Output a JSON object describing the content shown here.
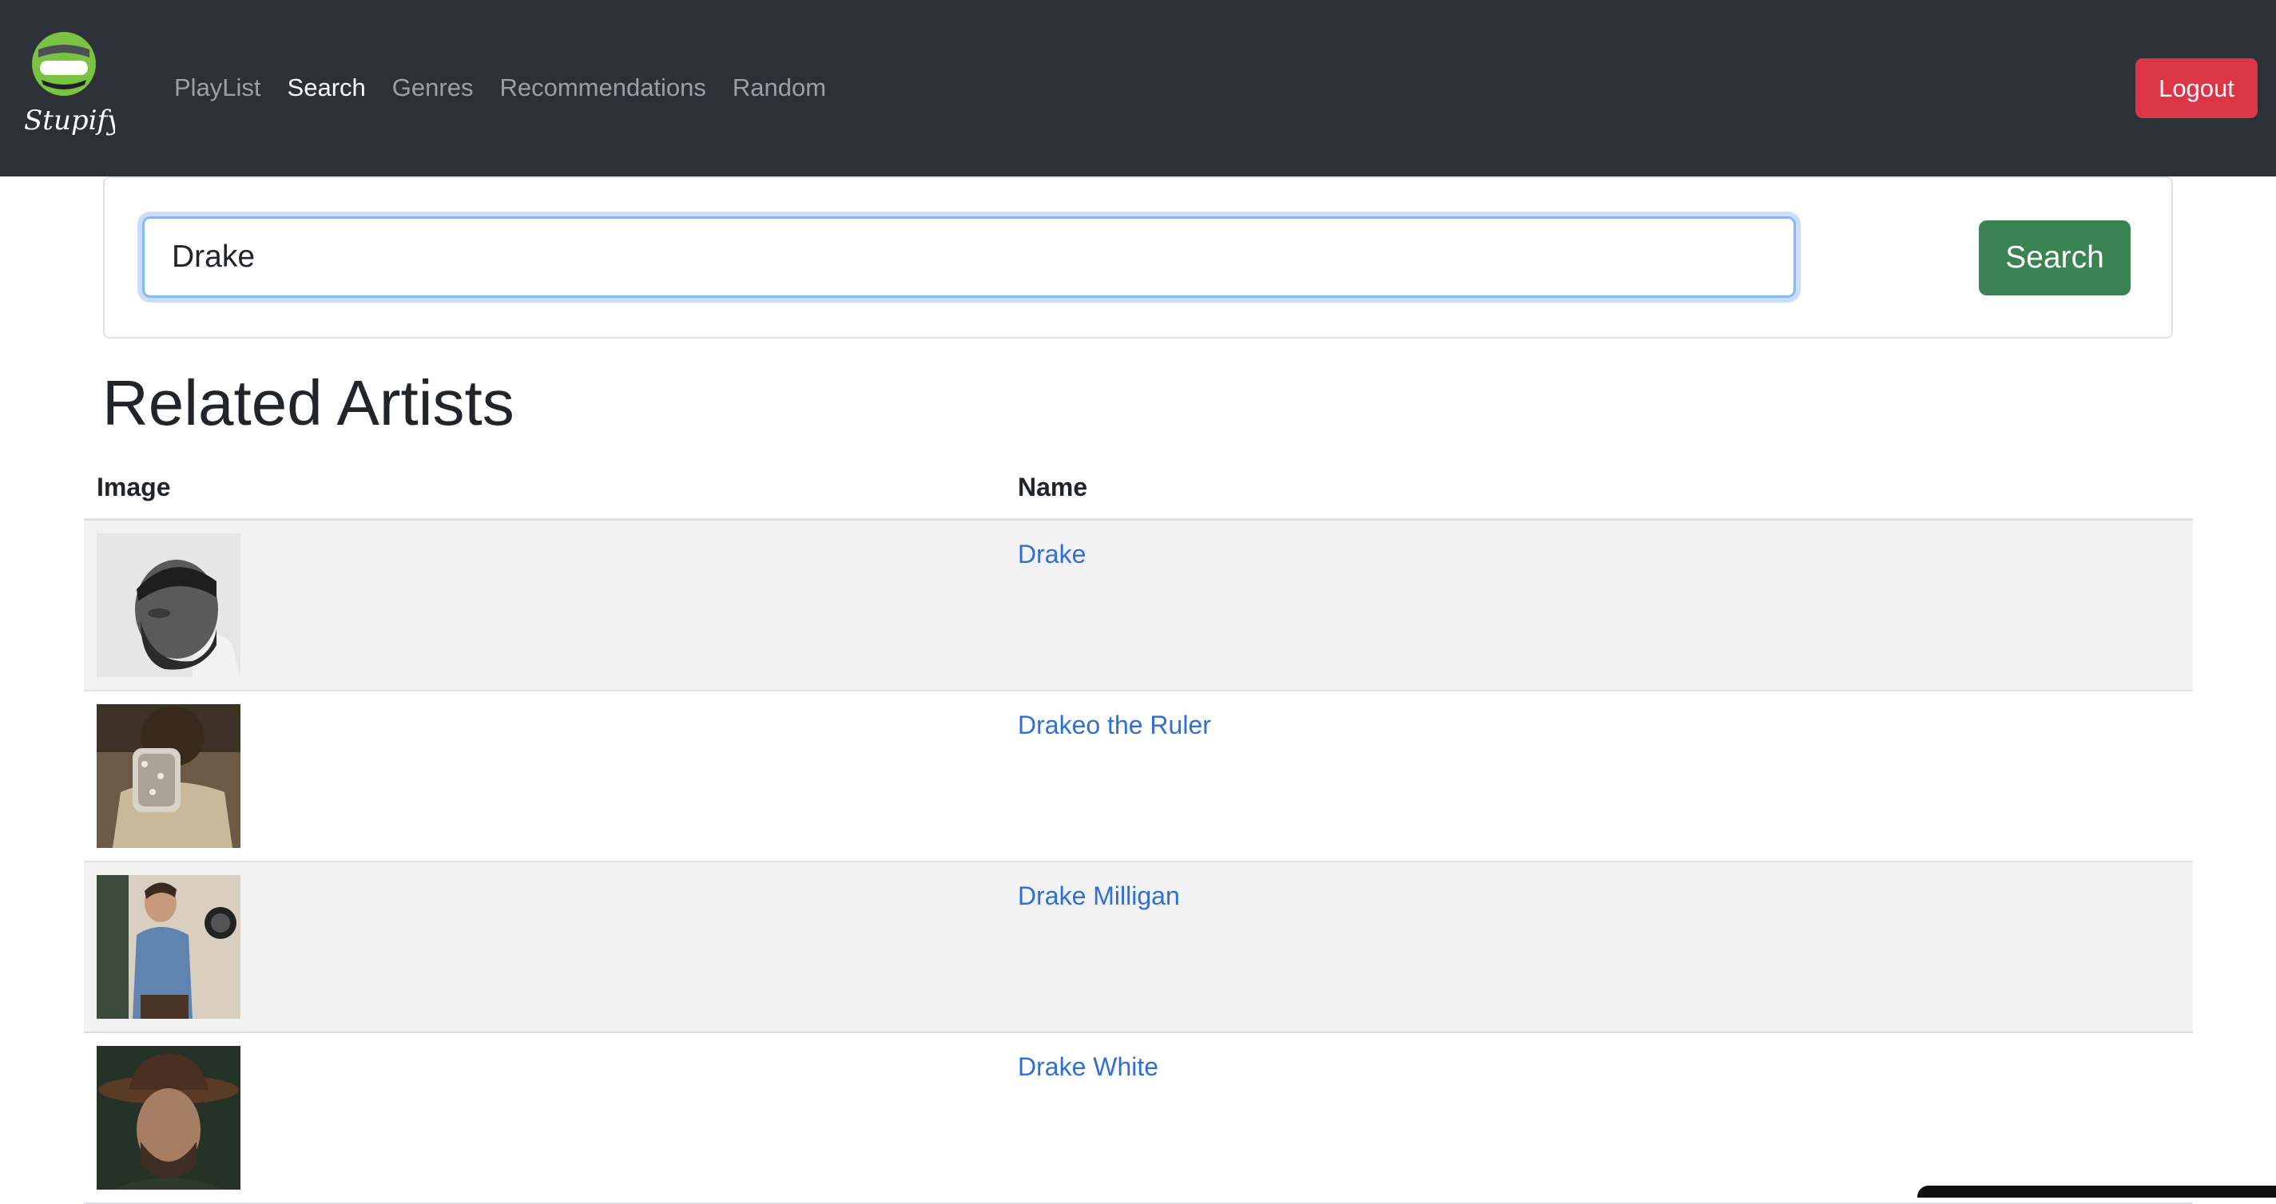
{
  "app": {
    "logo_text": "Stupify"
  },
  "nav": {
    "items": [
      {
        "label": "PlayList",
        "active": false
      },
      {
        "label": "Search",
        "active": true
      },
      {
        "label": "Genres",
        "active": false
      },
      {
        "label": "Recommendations",
        "active": false
      },
      {
        "label": "Random",
        "active": false
      }
    ],
    "logout_label": "Logout"
  },
  "search": {
    "value": "Drake",
    "button_label": "Search"
  },
  "results": {
    "title": "Related Artists",
    "columns": [
      "Image",
      "Name"
    ],
    "rows": [
      {
        "name": "Drake"
      },
      {
        "name": "Drakeo the Ruler"
      },
      {
        "name": "Drake Milligan"
      },
      {
        "name": "Drake White"
      }
    ]
  },
  "colors": {
    "navbar_bg": "#2c3037",
    "logout": "#dc3545",
    "search_button": "#3a8454",
    "link": "#2f6fd6",
    "logo_green": "#7cc242"
  }
}
